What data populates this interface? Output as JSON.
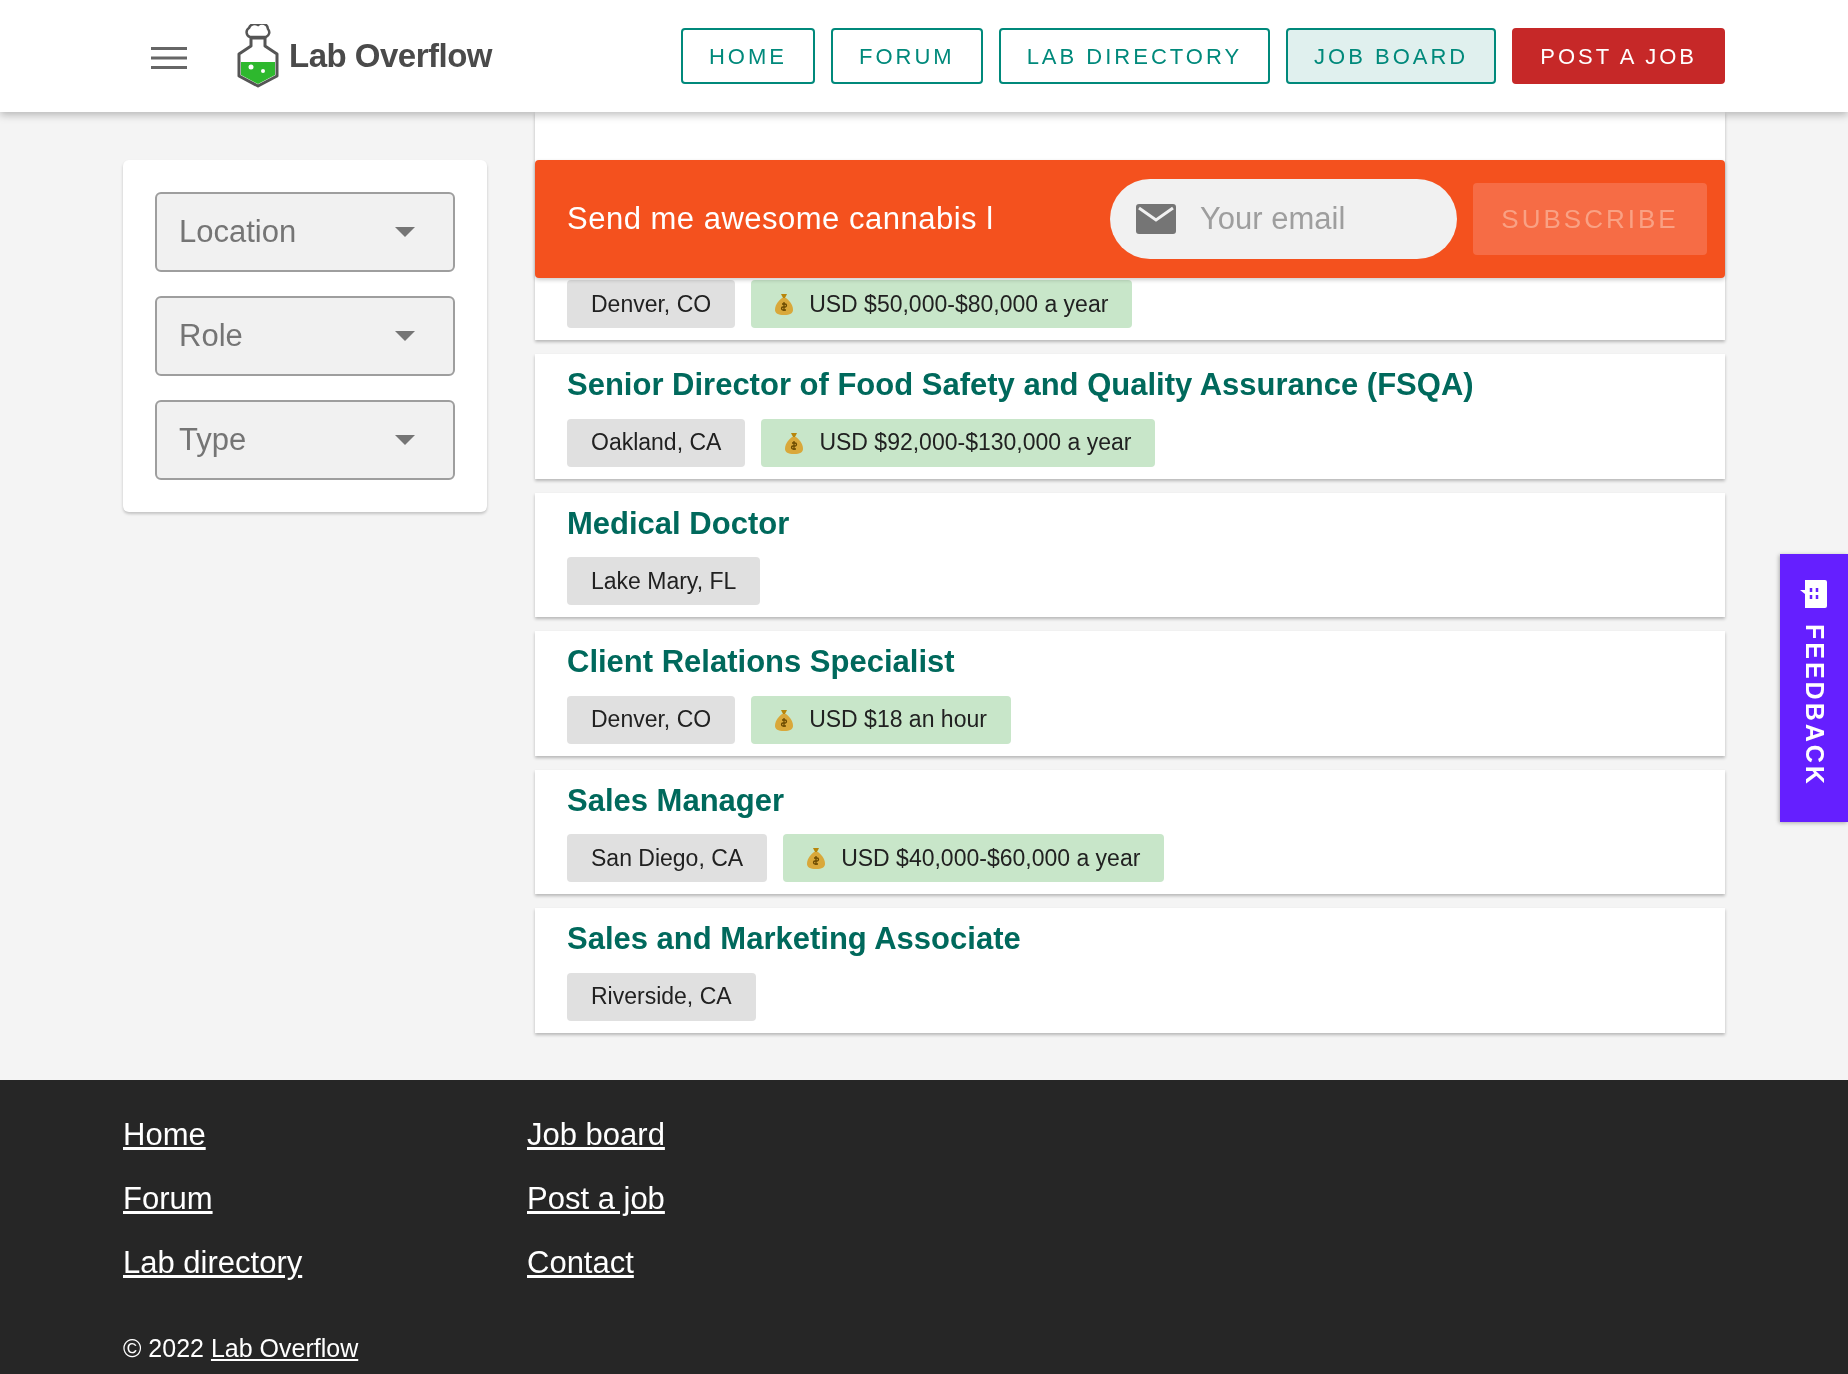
{
  "header": {
    "brand": "Lab Overflow",
    "nav": [
      {
        "label": "HOME",
        "kind": "outline",
        "selected": false
      },
      {
        "label": "FORUM",
        "kind": "outline",
        "selected": false
      },
      {
        "label": "LAB DIRECTORY",
        "kind": "outline",
        "selected": false
      },
      {
        "label": "JOB BOARD",
        "kind": "outline",
        "selected": true
      },
      {
        "label": "POST A JOB",
        "kind": "filled",
        "selected": false
      }
    ]
  },
  "filters": [
    {
      "label": "Location"
    },
    {
      "label": "Role"
    },
    {
      "label": "Type"
    }
  ],
  "subscribe": {
    "text": "Send me awesome cannabis l",
    "placeholder": "Your email",
    "button": "SUBSCRIBE",
    "disabled": true
  },
  "jobs": [
    {
      "tags": [
        {
          "kind": "location",
          "text": "Denver, CO"
        },
        {
          "kind": "salary",
          "text": "USD $50,000-$80,000 a year"
        }
      ]
    },
    {
      "title": "Senior Director of Food Safety and Quality Assurance (FSQA)",
      "tags": [
        {
          "kind": "location",
          "text": "Oakland, CA"
        },
        {
          "kind": "salary",
          "text": "USD $92,000-$130,000 a year"
        }
      ]
    },
    {
      "title": "Medical Doctor",
      "tags": [
        {
          "kind": "location",
          "text": "Lake Mary, FL"
        }
      ]
    },
    {
      "title": "Client Relations Specialist",
      "tags": [
        {
          "kind": "location",
          "text": "Denver, CO"
        },
        {
          "kind": "salary",
          "text": "USD $18 an hour"
        }
      ]
    },
    {
      "title": "Sales Manager",
      "tags": [
        {
          "kind": "location",
          "text": "San Diego, CA"
        },
        {
          "kind": "salary",
          "text": "USD $40,000-$60,000 a year"
        }
      ]
    },
    {
      "title": "Sales and Marketing Associate",
      "tags": [
        {
          "kind": "location",
          "text": "Riverside, CA"
        }
      ]
    }
  ],
  "feedback": {
    "label": "FEEDBACK"
  },
  "footer": {
    "columns": [
      [
        "Home",
        "Forum",
        "Lab directory"
      ],
      [
        "Job board",
        "Post a job",
        "Contact"
      ]
    ],
    "copyright": {
      "text": "© 2022 ",
      "link": "Lab Overflow"
    }
  }
}
